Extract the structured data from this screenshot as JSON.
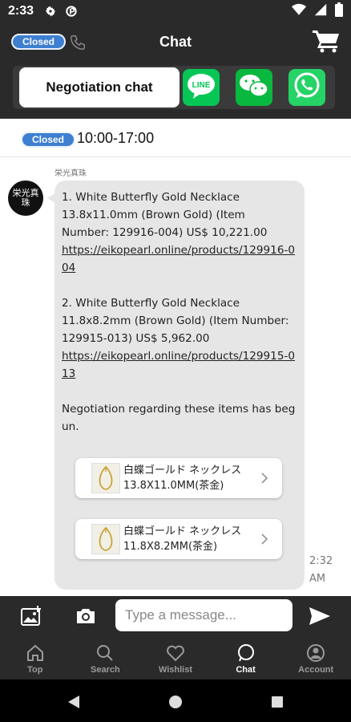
{
  "status_bar": {
    "time": "2:33"
  },
  "header": {
    "status_badge": "Closed",
    "title": "Chat",
    "negotiation_tab": "Negotiation chat",
    "apps": [
      "line-icon",
      "wechat-icon",
      "whatsapp-icon"
    ]
  },
  "business_hours": {
    "badge": "Closed",
    "hours": "10:00-17:00"
  },
  "message": {
    "sender": "栄光真珠",
    "avatar_text": "栄光真珠",
    "item1_line1": "1. White Butterfly Gold Necklace",
    "item1_line2": "13.8x11.0mm (Brown Gold) (Item",
    "item1_line3": "Number: 129916-004) US$ 10,221.00",
    "item1_link": "https://eikopearl.online/products/129916-004",
    "item2_line1": "2. White Butterfly Gold Necklace",
    "item2_line2": "11.8x8.2mm (Brown Gold) (Item Number:",
    "item2_line3": "129915-013) US$ 5,962.00",
    "item2_link": "https://eikopearl.online/products/129915-013",
    "negotiation_text": "Negotiation regarding these items has begun.",
    "cards": [
      {
        "name_line1": "白蝶ゴールド ネックレス",
        "name_line2": "13.8X11.0MM(茶金)"
      },
      {
        "name_line1": "白蝶ゴールド ネックレス",
        "name_line2": "11.8X8.2MM(茶金)"
      }
    ],
    "time": "2:32 AM"
  },
  "input": {
    "placeholder": "Type a message..."
  },
  "nav": {
    "items": [
      {
        "label": "Top",
        "icon": "home-icon"
      },
      {
        "label": "Search",
        "icon": "search-icon"
      },
      {
        "label": "Wishlist",
        "icon": "heart-icon"
      },
      {
        "label": "Chat",
        "icon": "chat-icon",
        "active": true
      },
      {
        "label": "Account",
        "icon": "account-icon"
      }
    ]
  },
  "colors": {
    "dark_bg": "#2a2a2a",
    "badge_blue": "#3d7fd0",
    "bubble_gray": "#e6e6e6",
    "line_green": "#06c755",
    "wechat_green": "#09b83e",
    "whatsapp_green": "#25d366"
  }
}
